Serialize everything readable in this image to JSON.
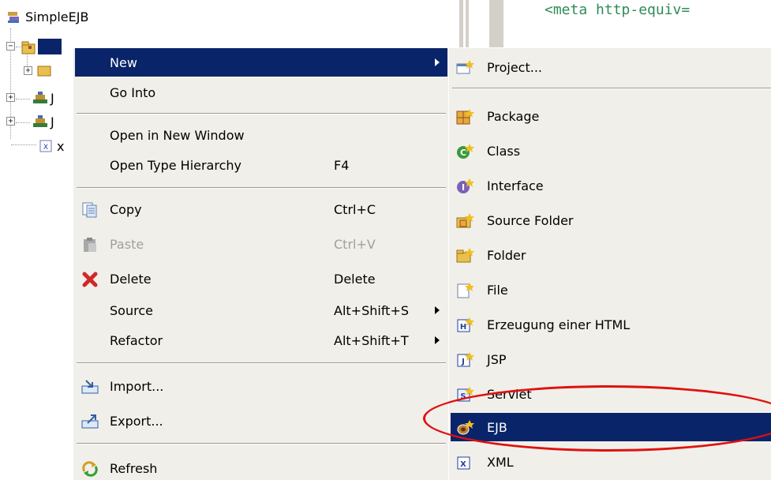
{
  "tree": {
    "project_label": "SimpleEJB",
    "rows": [
      "J",
      "J",
      "x"
    ]
  },
  "editor": {
    "code": "<meta http-equiv="
  },
  "context_menu": {
    "items": [
      {
        "label": "New",
        "shortcut": "",
        "submenu": true,
        "selected": true
      },
      {
        "label": "Go Into",
        "shortcut": ""
      },
      {
        "label": "Open in New Window",
        "shortcut": ""
      },
      {
        "label": "Open Type Hierarchy",
        "shortcut": "F4"
      },
      {
        "label": "Copy",
        "shortcut": "Ctrl+C",
        "icon": "copy-icon"
      },
      {
        "label": "Paste",
        "shortcut": "Ctrl+V",
        "icon": "paste-icon",
        "disabled": true
      },
      {
        "label": "Delete",
        "shortcut": "Delete",
        "icon": "delete-icon"
      },
      {
        "label": "Source",
        "shortcut": "Alt+Shift+S",
        "submenu": true
      },
      {
        "label": "Refactor",
        "shortcut": "Alt+Shift+T",
        "submenu": true
      },
      {
        "label": "Import...",
        "shortcut": "",
        "icon": "import-icon"
      },
      {
        "label": "Export...",
        "shortcut": "",
        "icon": "export-icon"
      },
      {
        "label": "Refresh",
        "shortcut": "",
        "icon": "refresh-icon"
      }
    ]
  },
  "new_submenu": {
    "items": [
      {
        "label": "Project...",
        "icon": "new-project-icon"
      },
      {
        "label": "Package",
        "icon": "new-package-icon"
      },
      {
        "label": "Class",
        "icon": "new-class-icon"
      },
      {
        "label": "Interface",
        "icon": "new-interface-icon"
      },
      {
        "label": "Source Folder",
        "icon": "new-source-folder-icon"
      },
      {
        "label": "Folder",
        "icon": "new-folder-icon"
      },
      {
        "label": "File",
        "icon": "new-file-icon"
      },
      {
        "label": "Erzeugung einer HTML",
        "icon": "new-html-icon"
      },
      {
        "label": "JSP",
        "icon": "new-jsp-icon"
      },
      {
        "label": "Servlet",
        "icon": "new-servlet-icon"
      },
      {
        "label": "EJB",
        "icon": "new-ejb-icon",
        "selected": true
      },
      {
        "label": "XML",
        "icon": "new-xml-icon"
      }
    ]
  },
  "colors": {
    "menu_bg": "#f1efe9",
    "selection": "#0a246a",
    "annotation": "#e01010",
    "code": "#2e8b57"
  }
}
